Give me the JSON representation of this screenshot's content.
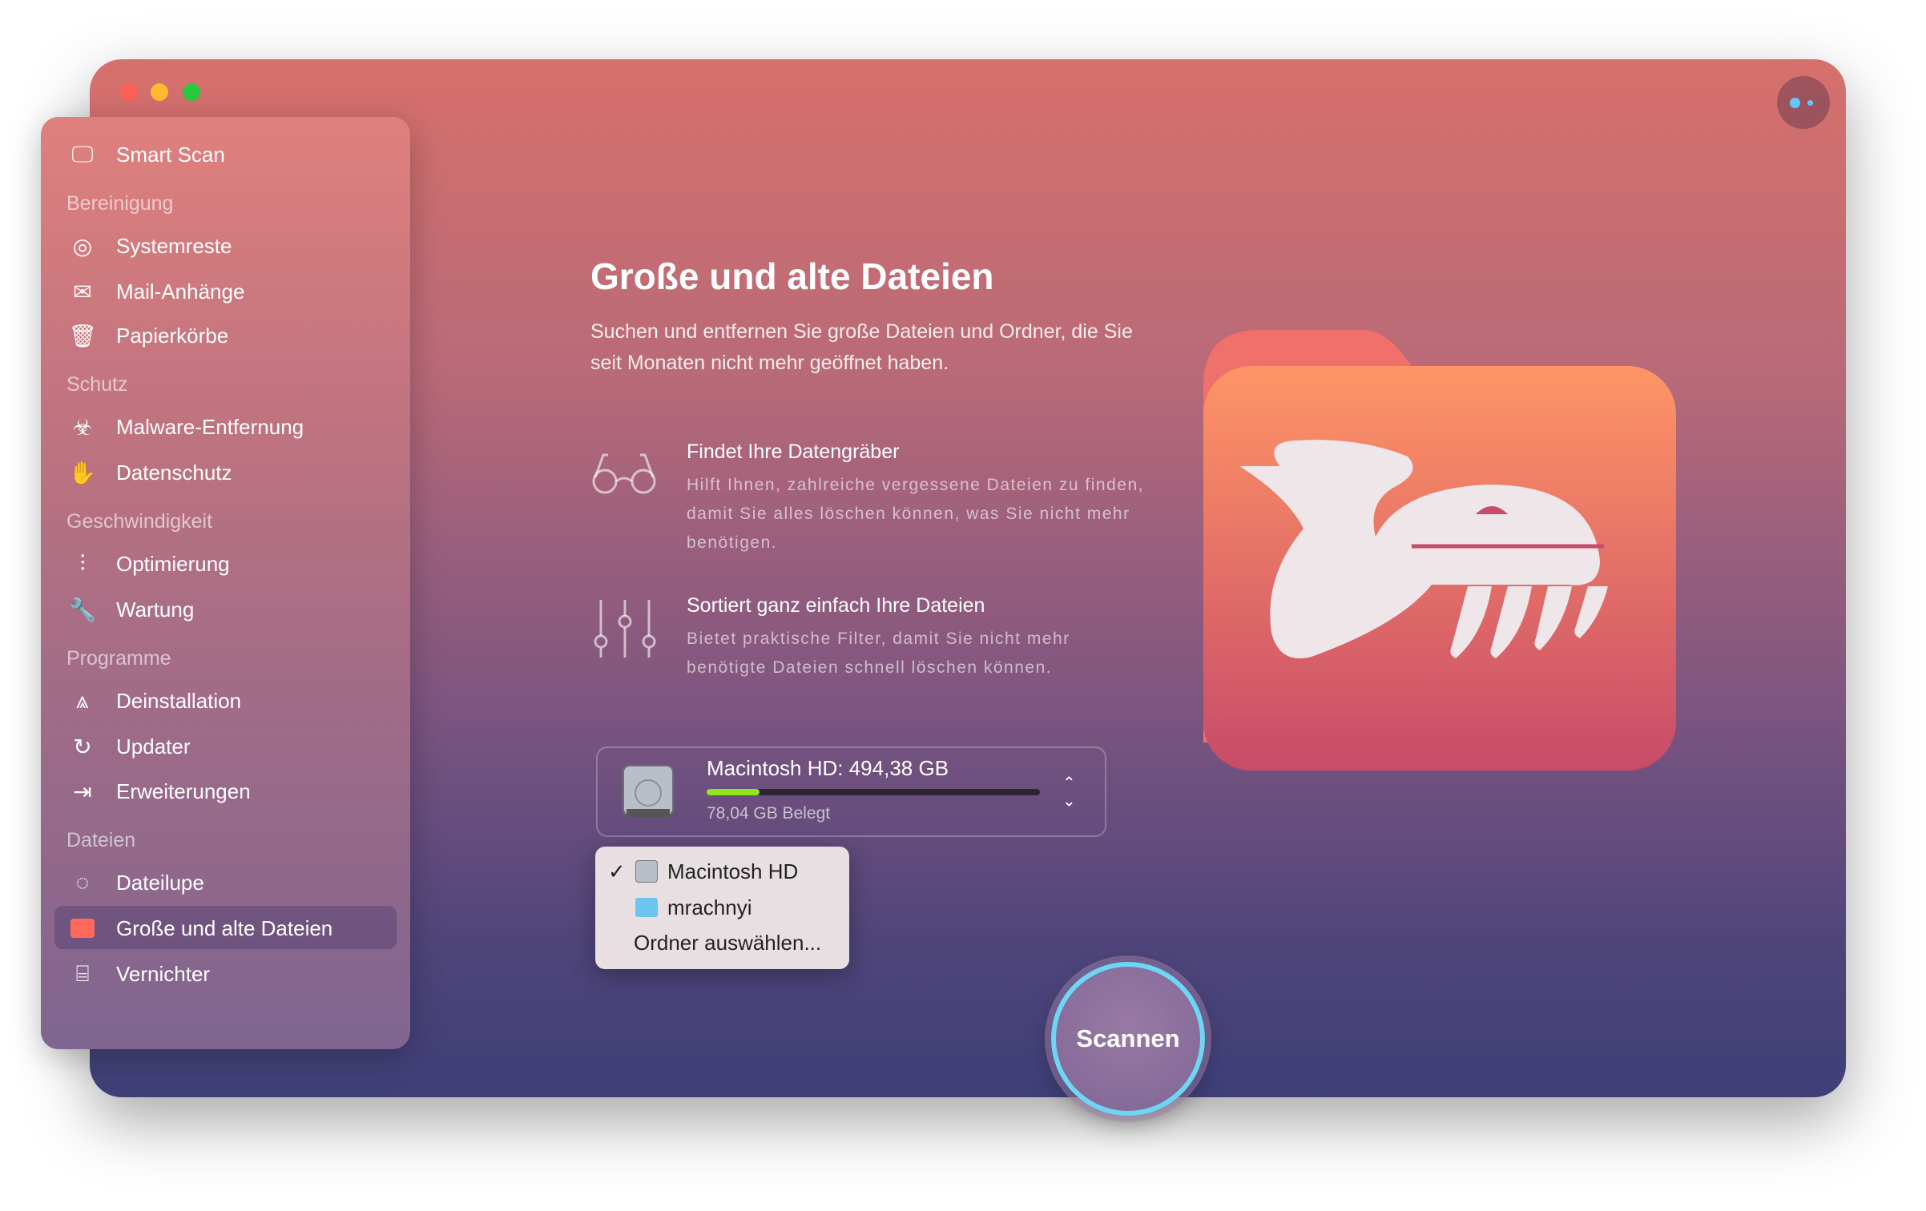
{
  "window": {
    "traffic_lights": [
      "#fe5f57",
      "#febc2e",
      "#28c840"
    ],
    "assistant_button": "assistant-icon"
  },
  "sidebar": {
    "smart_scan": "Smart Scan",
    "sections": [
      {
        "heading": "Bereinigung",
        "items": [
          "Systemreste",
          "Mail-Anhänge",
          "Papierkörbe"
        ]
      },
      {
        "heading": "Schutz",
        "items": [
          "Malware-Entfernung",
          "Datenschutz"
        ]
      },
      {
        "heading": "Geschwindigkeit",
        "items": [
          "Optimierung",
          "Wartung"
        ]
      },
      {
        "heading": "Programme",
        "items": [
          "Deinstallation",
          "Updater",
          "Erweiterungen"
        ]
      },
      {
        "heading": "Dateien",
        "items": [
          "Dateilupe",
          "Große und alte Dateien",
          "Vernichter"
        ]
      }
    ],
    "selected": "Große und alte Dateien"
  },
  "main": {
    "title": "Große und alte Dateien",
    "description": "Suchen und entfernen Sie große Dateien und Ordner, die Sie seit Monaten nicht mehr geöffnet haben.",
    "features": [
      {
        "title": "Findet Ihre Datengräber",
        "text": "Hilft Ihnen, zahlreiche vergessene Dateien zu finden, damit Sie alles löschen können, was Sie nicht mehr benötigen.",
        "icon": "glasses-icon"
      },
      {
        "title": "Sortiert ganz einfach Ihre Dateien",
        "text": "Bietet praktische Filter, damit Sie nicht mehr benötigte Dateien schnell löschen können.",
        "icon": "sliders-icon"
      }
    ],
    "drive": {
      "name": "Macintosh HD: 494,38 GB",
      "used": "78,04 GB Belegt",
      "used_fraction": 0.158,
      "bar_color": "#8fe61f"
    },
    "menu": {
      "items": [
        "Macintosh HD",
        "mrachnyi",
        "Ordner auswählen..."
      ],
      "checked": "Macintosh HD"
    },
    "scan_button": "Scannen"
  }
}
